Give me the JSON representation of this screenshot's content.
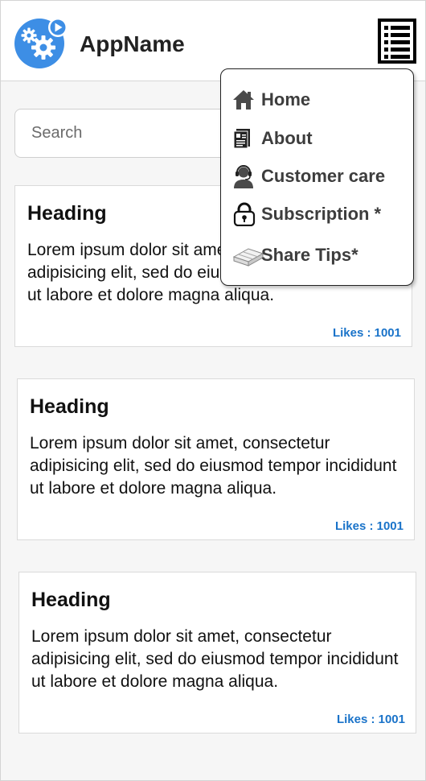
{
  "header": {
    "app_name": "AppName",
    "logo_icon": "gears-play-icon",
    "menu_icon": "menu-list-icon"
  },
  "search": {
    "placeholder": "Search",
    "value": ""
  },
  "cards": [
    {
      "heading": "Heading",
      "body": "Lorem ipsum dolor sit amet, consectetur adipisicing elit, sed do eiusmod tempor incididunt ut labore et dolore magna aliqua.",
      "likes_label": "Likes : ",
      "likes_value": "1001"
    },
    {
      "heading": "Heading",
      "body": "Lorem ipsum dolor sit amet, consectetur adipisicing elit, sed do eiusmod tempor incididunt ut labore et dolore magna aliqua.",
      "likes_label": "Likes : ",
      "likes_value": "1001"
    },
    {
      "heading": "Heading",
      "body": "Lorem ipsum dolor sit amet, consectetur adipisicing elit, sed do eiusmod tempor incididunt ut labore et dolore magna aliqua.",
      "likes_label": "Likes : ",
      "likes_value": "1001"
    }
  ],
  "menu": {
    "items": [
      {
        "label": "Home",
        "icon": "home-icon"
      },
      {
        "label": "About",
        "icon": "id-card-icon"
      },
      {
        "label": "Customer care",
        "icon": "headset-agent-icon"
      },
      {
        "label": "Subscription *",
        "icon": "lock-icon"
      },
      {
        "label": "Share Tips*",
        "icon": "paper-ream-icon"
      }
    ]
  },
  "colors": {
    "brand_blue": "#3d8ee5",
    "likes_blue": "#1a73c9",
    "menu_text": "#3d3d3d"
  }
}
